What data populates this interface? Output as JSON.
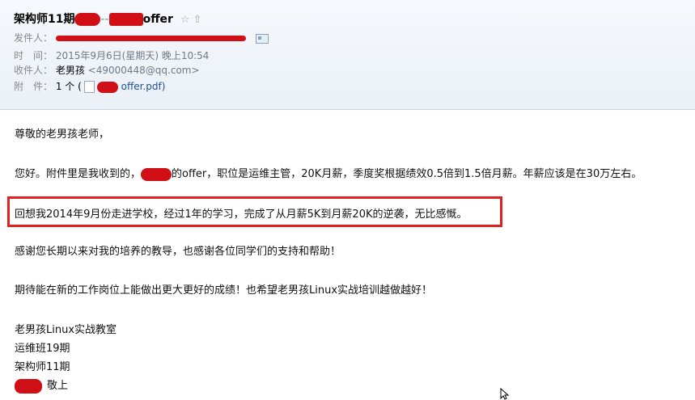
{
  "header": {
    "subject_prefix": "架构师11期",
    "subject_sep": "--",
    "subject_suffix": "offer",
    "star_glyph": "☆",
    "share_glyph": "⇧",
    "from_label": "发件人：",
    "time_label": "时　间：",
    "time_value": "2015年9月6日(星期天) 晚上10:54",
    "to_label": "收件人：",
    "to_name": "老男孩",
    "to_email": "<49000448@qq.com>",
    "attach_label": "附　件：",
    "attach_count": "1 个 (",
    "attach_file": "offer.pdf)"
  },
  "body": {
    "greeting": "尊敬的老男孩老师，",
    "para1_a": "您好。附件里是我收到的，",
    "para1_b": "的offer，职位是运维主管，20K月薪，季度奖根据绩效0.5倍到1.5倍月薪。年薪应该是在30万左右。",
    "para2": "回想我2014年9月份走进学校，经过1年的学习，完成了从月薪5K到月薪20K的逆袭，无比感慨。",
    "para3": "感谢您长期以来对我的培养的教导，也感谢各位同学们的支持和帮助！",
    "para4": "期待能在新的工作岗位上能做出更大更好的成绩！也希望老男孩Linux实战培训越做越好！",
    "sig_line1": "老男孩Linux实战教室",
    "sig_line2": "运维班19期",
    "sig_line3": "架构师11期",
    "sig_closing": "敬上"
  },
  "colors": {
    "redaction": "#d10f16",
    "highlight_border": "#e02020",
    "link": "#1d4f91"
  }
}
